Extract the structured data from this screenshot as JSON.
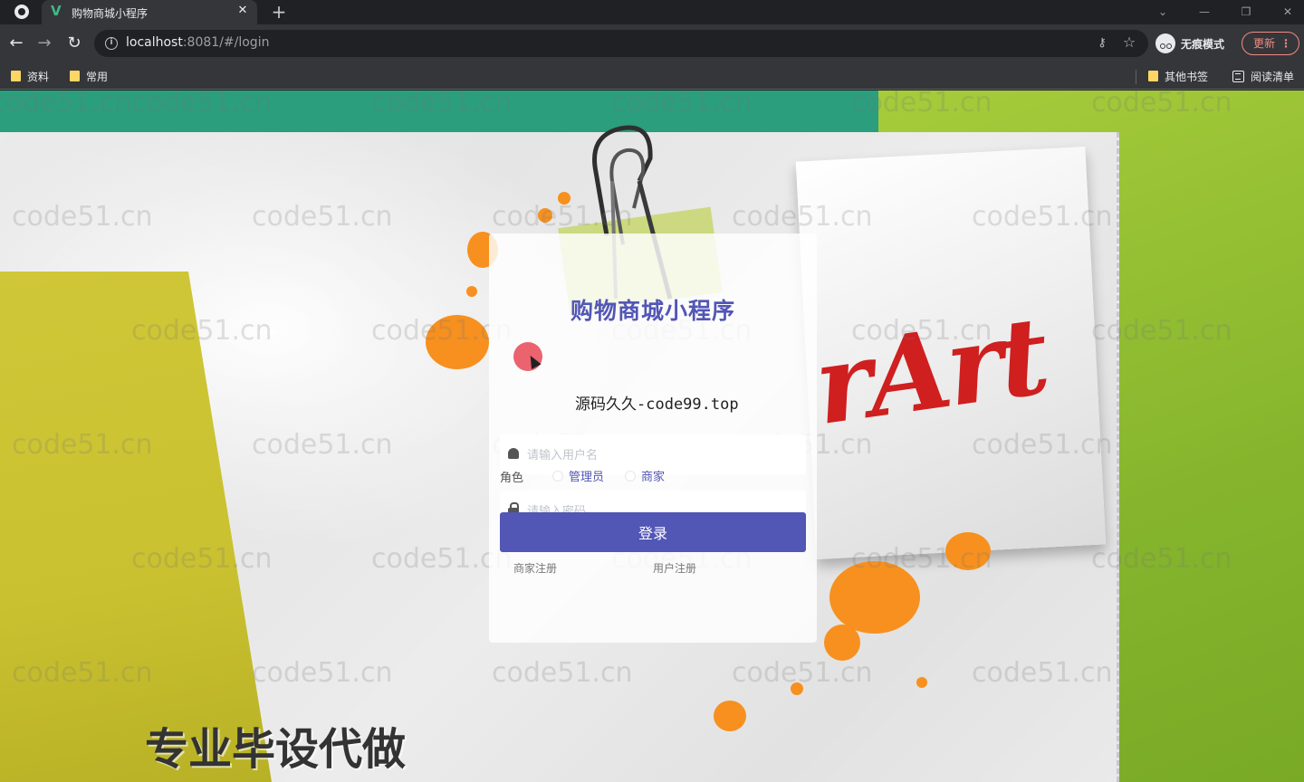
{
  "browser": {
    "tab_title": "购物商城小程序",
    "tab_favicon": "V",
    "url_host": "localhost",
    "url_rest": ":8081/#/login",
    "incognito_label": "无痕模式",
    "update_label": "更新",
    "bookmarks": [
      "资料",
      "常用"
    ],
    "bookmarks_right": [
      "其他书签",
      "阅读清单"
    ]
  },
  "page": {
    "title": "购物商城小程序",
    "username_placeholder": "请输入用户名",
    "password_placeholder": "请输入密码",
    "role_label": "角色",
    "roles": [
      "管理员",
      "商家"
    ],
    "login_button": "登录",
    "links": [
      "商家注册",
      "用户注册"
    ],
    "overlay_text": "源码久久-code99.top",
    "promo_text": "专业毕设代做",
    "watermark_text": "code51.cn",
    "background_art_text": "rArt"
  },
  "colors": {
    "accent": "#5256b5",
    "teal": "#2a9e7d",
    "lime": "#a6cc3a",
    "yellow": "#cfc737",
    "splash": "#f7901e",
    "art_red": "#cf1f1f"
  },
  "icons": [
    "chrome-icon",
    "vue-favicon",
    "close-icon",
    "plus-icon",
    "back-icon",
    "forward-icon",
    "reload-icon",
    "info-icon",
    "key-icon",
    "star-icon",
    "incognito-icon",
    "folder-icon",
    "reading-list-icon",
    "user-icon",
    "lock-icon"
  ]
}
